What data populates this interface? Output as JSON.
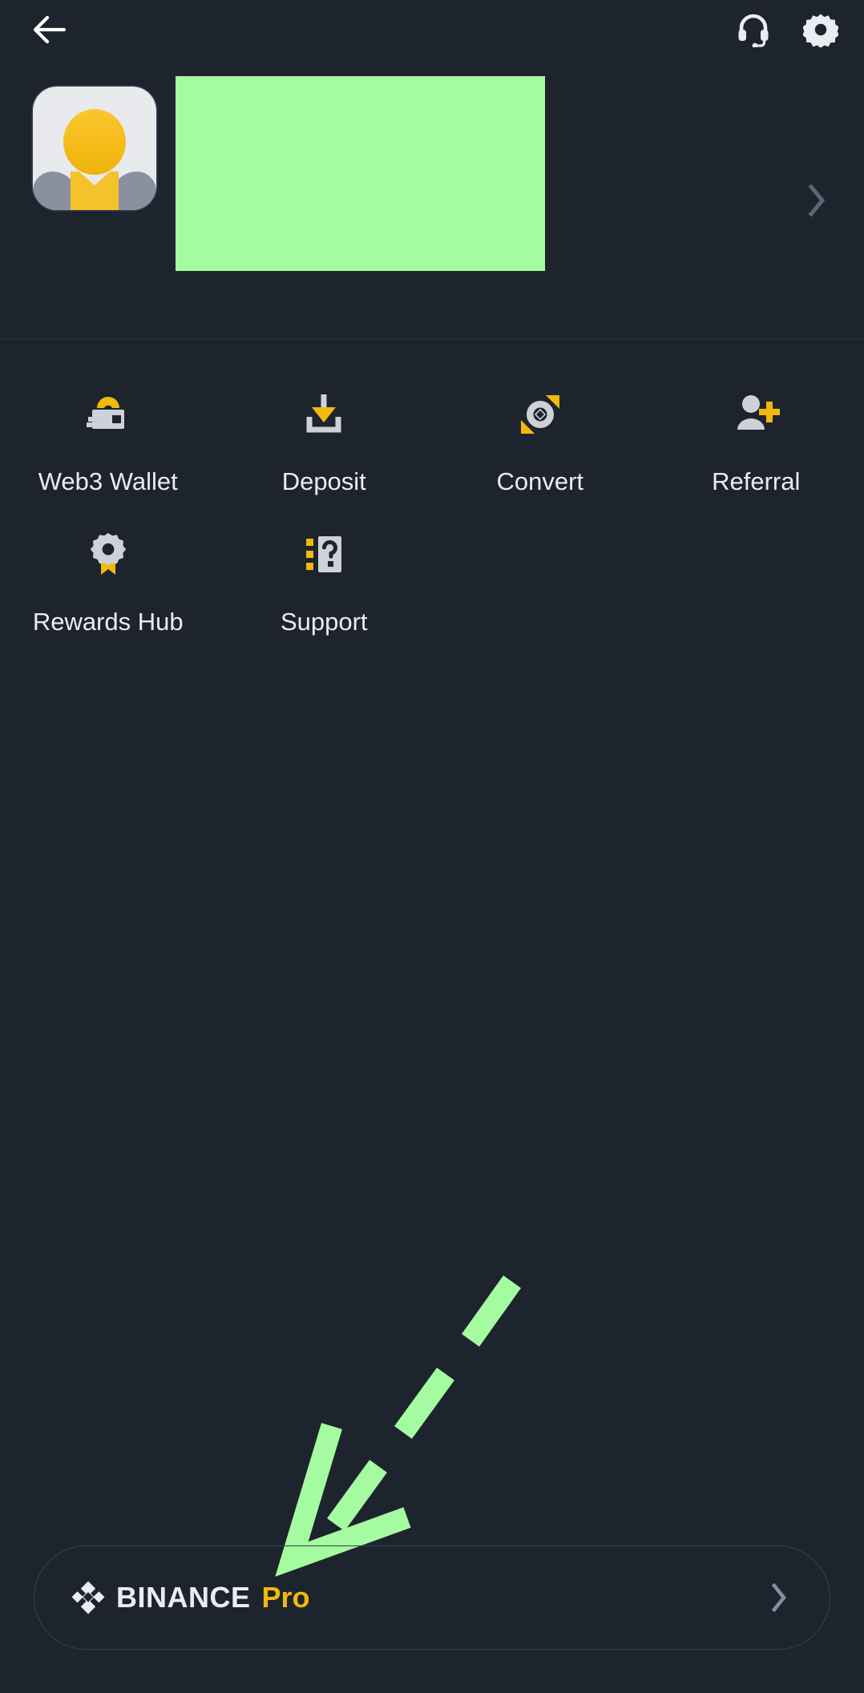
{
  "theme": {
    "background": "#1e242e",
    "accent_yellow": "#f0b90b",
    "text_primary": "#eaecef",
    "annotation_green": "#a4fba0",
    "divider": "#2e3542",
    "icon_gray": "#ced2d8"
  },
  "topbar": {
    "back_icon": "arrow-left-icon",
    "support_icon": "headset-icon",
    "settings_icon": "gear-icon"
  },
  "profile": {
    "avatar_icon": "user-avatar-icon",
    "name_redacted": "",
    "chevron_icon": "chevron-right-icon"
  },
  "grid": {
    "items": [
      {
        "label": "Web3 Wallet",
        "icon": "wallet-icon"
      },
      {
        "label": "Deposit",
        "icon": "deposit-icon"
      },
      {
        "label": "Convert",
        "icon": "convert-icon"
      },
      {
        "label": "Referral",
        "icon": "referral-icon"
      },
      {
        "label": "Rewards Hub",
        "icon": "rewards-badge-icon"
      },
      {
        "label": "Support",
        "icon": "support-help-icon"
      }
    ]
  },
  "annotation": {
    "shape": "dashed-arrow-pointing-down-left",
    "color": "#a4fba0",
    "dash_count": 3
  },
  "pro_button": {
    "logo_icon": "binance-logo-icon",
    "brand": "BINANCE",
    "tag": "Pro",
    "chevron_icon": "chevron-right-icon"
  }
}
